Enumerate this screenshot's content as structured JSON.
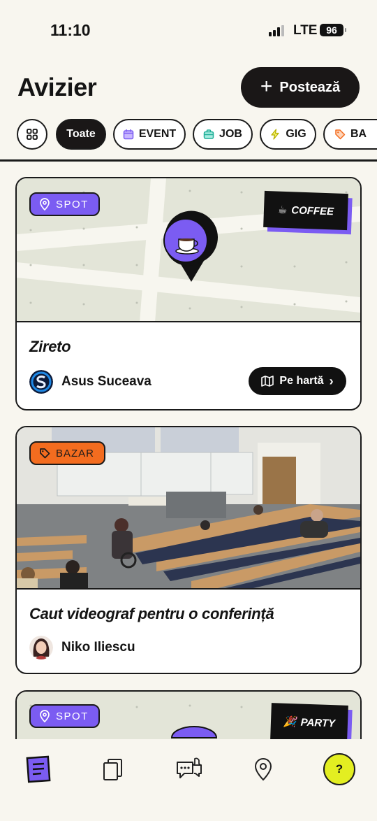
{
  "status": {
    "time": "11:10",
    "network": "LTE",
    "battery": "96"
  },
  "header": {
    "title": "Avizier",
    "post_label": "Postează"
  },
  "filters": [
    {
      "label": "Toate",
      "active": true
    },
    {
      "label": "EVENT",
      "active": false
    },
    {
      "label": "JOB",
      "active": false
    },
    {
      "label": "GIG",
      "active": false
    },
    {
      "label": "BA",
      "active": false
    }
  ],
  "posts": [
    {
      "badge": "SPOT",
      "tag": "COFFEE",
      "title": "Zireto",
      "author": "Asus Suceava",
      "action": "Pe hartă"
    },
    {
      "badge": "BAZAR",
      "title": "Caut videograf pentru o conferință",
      "author": "Niko Iliescu"
    },
    {
      "badge": "SPOT",
      "tag": "PARTY"
    }
  ],
  "nav": [
    "board-icon",
    "cards-icon",
    "messages-icon",
    "location-icon"
  ],
  "help": "?",
  "colors": {
    "accent": "#7b5cf2",
    "bazar": "#f36c1f",
    "help": "#e3ee21",
    "dark": "#1a1717"
  }
}
